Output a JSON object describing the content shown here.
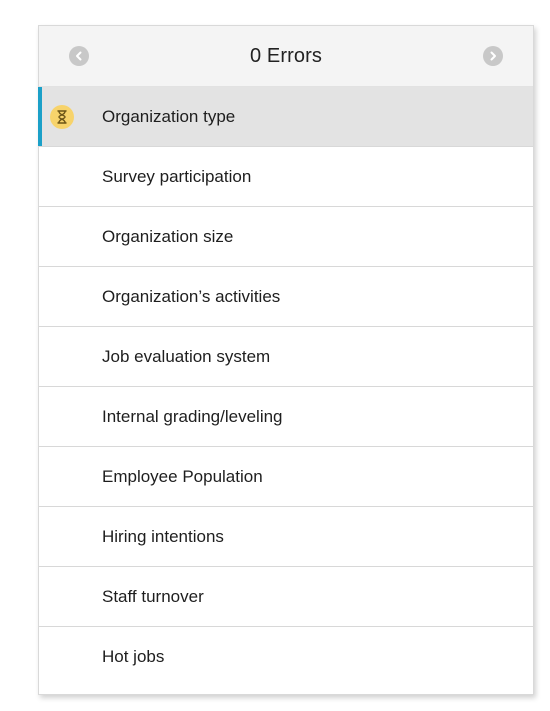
{
  "header": {
    "title": "0 Errors",
    "prev_icon": "chevron-left-icon",
    "next_icon": "chevron-right-icon"
  },
  "colors": {
    "accent": "#1ba0c8",
    "status_badge": "#f7d36b",
    "active_bg": "#e3e3e3"
  },
  "sections": [
    {
      "label": "Organization type",
      "active": true,
      "status_icon": "hourglass-icon"
    },
    {
      "label": "Survey participation"
    },
    {
      "label": "Organization size"
    },
    {
      "label": "Organization’s activities"
    },
    {
      "label": "Job evaluation system"
    },
    {
      "label": "Internal grading/leveling"
    },
    {
      "label": "Employee Population"
    },
    {
      "label": "Hiring intentions"
    },
    {
      "label": "Staff turnover"
    },
    {
      "label": "Hot jobs"
    }
  ]
}
